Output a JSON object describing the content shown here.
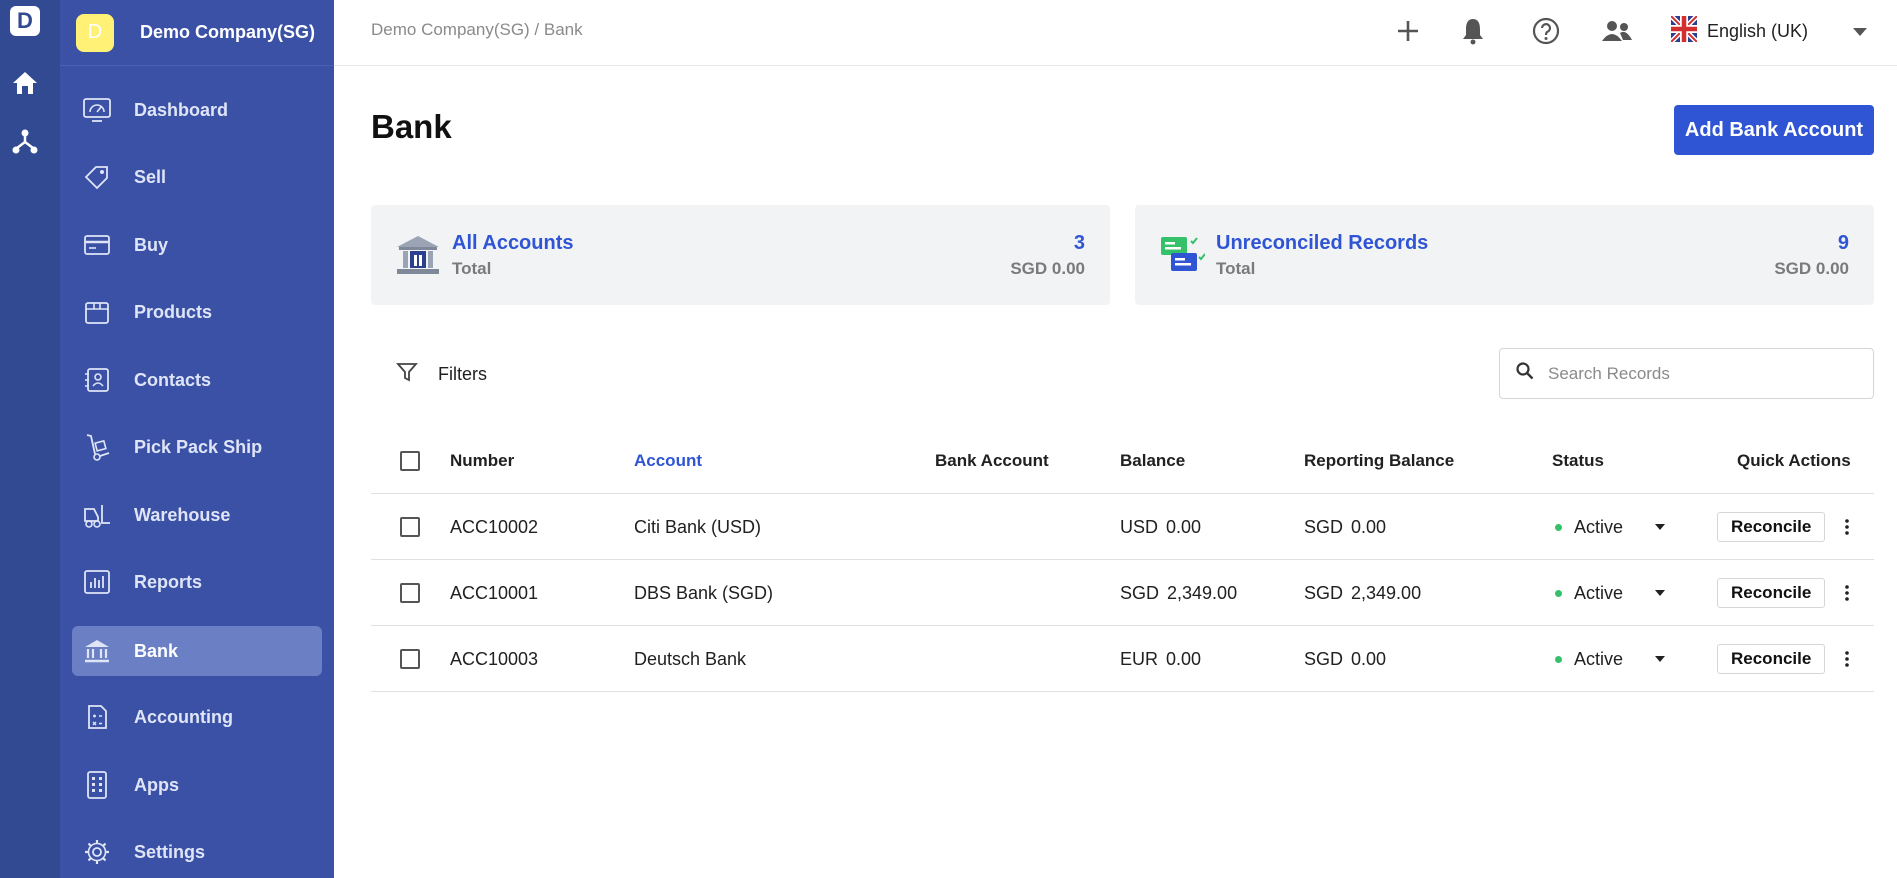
{
  "rail": {
    "logo_letter": "D",
    "icons": [
      "home-icon",
      "network-icon"
    ]
  },
  "sidebar": {
    "company_initial": "D",
    "company_name": "Demo Company(SG)",
    "items": [
      {
        "label": "Dashboard",
        "icon": "dashboard-icon"
      },
      {
        "label": "Sell",
        "icon": "tag-icon"
      },
      {
        "label": "Buy",
        "icon": "card-icon"
      },
      {
        "label": "Products",
        "icon": "box-icon"
      },
      {
        "label": "Contacts",
        "icon": "contacts-icon"
      },
      {
        "label": "Pick Pack Ship",
        "icon": "dolly-icon"
      },
      {
        "label": "Warehouse",
        "icon": "forklift-icon"
      },
      {
        "label": "Reports",
        "icon": "reports-icon"
      },
      {
        "label": "Bank",
        "icon": "bank-icon"
      },
      {
        "label": "Accounting",
        "icon": "calculator-icon"
      },
      {
        "label": "Apps",
        "icon": "apps-icon"
      },
      {
        "label": "Settings",
        "icon": "gear-icon"
      }
    ],
    "active_index": 8
  },
  "topbar": {
    "breadcrumb": "Demo Company(SG) / Bank",
    "language": "English (UK)"
  },
  "page": {
    "title": "Bank",
    "add_button": "Add Bank Account"
  },
  "cards": [
    {
      "title": "All Accounts",
      "sub": "Total",
      "count": "3",
      "amount": "SGD 0.00"
    },
    {
      "title": "Unreconciled Records",
      "sub": "Total",
      "count": "9",
      "amount": "SGD 0.00"
    }
  ],
  "filters": {
    "label": "Filters",
    "search_placeholder": "Search Records"
  },
  "table": {
    "headers": {
      "number": "Number",
      "account": "Account",
      "bank_account": "Bank Account",
      "balance": "Balance",
      "reporting_balance": "Reporting Balance",
      "status": "Status",
      "quick_actions": "Quick Actions"
    },
    "rows": [
      {
        "number": "ACC10002",
        "account": "Citi Bank (USD)",
        "bank_account": "",
        "bal_cur": "USD",
        "bal_val": "0.00",
        "rep_cur": "SGD",
        "rep_val": "0.00",
        "status": "Active",
        "action": "Reconcile"
      },
      {
        "number": "ACC10001",
        "account": "DBS Bank (SGD)",
        "bank_account": "",
        "bal_cur": "SGD",
        "bal_val": "2,349.00",
        "rep_cur": "SGD",
        "rep_val": "2,349.00",
        "status": "Active",
        "action": "Reconcile"
      },
      {
        "number": "ACC10003",
        "account": "Deutsch Bank",
        "bank_account": "",
        "bal_cur": "EUR",
        "bal_val": "0.00",
        "rep_cur": "SGD",
        "rep_val": "0.00",
        "status": "Active",
        "action": "Reconcile"
      }
    ]
  },
  "colors": {
    "rail": "#314a92",
    "sidebar": "#3a51a6",
    "active_item": "#6b7fc4",
    "accent": "#2f55d4",
    "status_active": "#35c06a"
  }
}
